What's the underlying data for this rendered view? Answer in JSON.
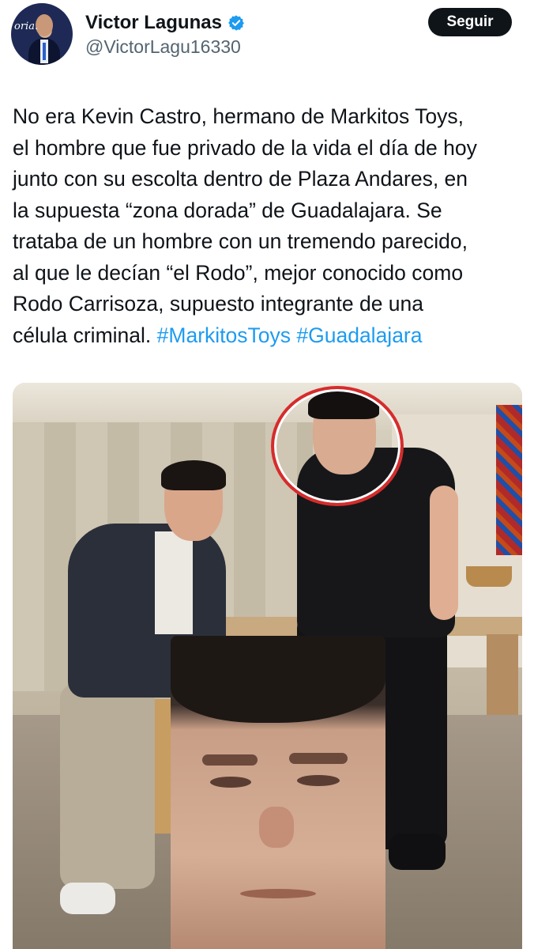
{
  "author": {
    "name": "Victor Lagunas",
    "handle": "@VictorLagu16330",
    "avatar_brand": "oria.",
    "verified_icon": "verified-badge-icon",
    "verified_color": "#1d9bf0"
  },
  "follow_button": {
    "label": "Seguir"
  },
  "tweet": {
    "lines": [
      "No era Kevin Castro, hermano de Markitos Toys,",
      "el hombre que fue privado de la vida el día de hoy",
      "junto con su escolta dentro de Plaza Andares, en",
      "la supuesta “zona dorada” de Guadalajara. Se",
      "trataba de un hombre con un tremendo parecido,",
      "al que le decían “el Rodo”, mejor conocido como",
      "Rodo Carrisoza, supuesto integrante de una",
      "célula criminal."
    ],
    "hashtags": [
      "#MarkitosToys",
      "#Guadalajara"
    ],
    "hashtag_color": "#1d9bf0"
  },
  "media": {
    "highlight_color": "#d62c2c"
  }
}
